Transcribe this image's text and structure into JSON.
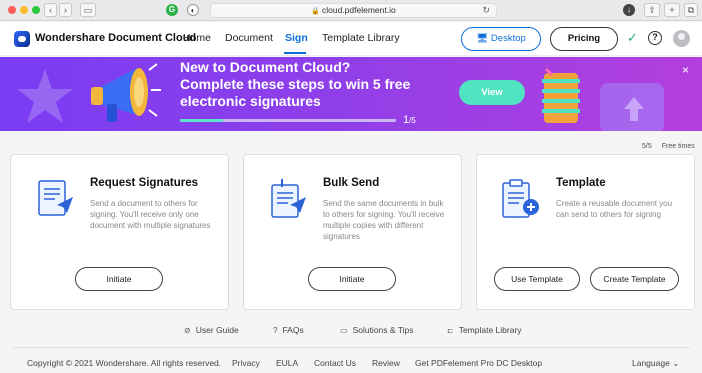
{
  "browser": {
    "url": "cloud.pdfelement.io",
    "nav_back": "‹",
    "nav_forward": "›"
  },
  "header": {
    "brand": "Wondershare Document Cloud",
    "nav": [
      "Home",
      "Document",
      "Sign",
      "Template Library"
    ],
    "active_nav": "Sign",
    "desktop_label": "Desktop",
    "pricing_label": "Pricing",
    "help_label": "?"
  },
  "banner": {
    "line1": "New to Document Cloud?",
    "line2": "Complete these steps to win 5 free",
    "line3": "electronic signatures",
    "progress_done": "1",
    "progress_total": "/5",
    "progress_fraction": 0.2,
    "view_label": "View",
    "close": "×"
  },
  "counter": {
    "value": "5/5",
    "label": "Free times"
  },
  "cards": [
    {
      "title": "Request Signatures",
      "desc": "Send a document to others for signing. You'll receive only one document with multiple signatures",
      "buttons": [
        "Initiate"
      ]
    },
    {
      "title": "Bulk Send",
      "desc": "Send the same documents in bulk to others for signing. You'll receive multiple copies with different signatures",
      "buttons": [
        "Initiate"
      ]
    },
    {
      "title": "Template",
      "desc": "Create a reusable document you can send to others for signing",
      "buttons": [
        "Use Template",
        "Create Template"
      ]
    }
  ],
  "footer": {
    "links": [
      "User Guide",
      "FAQs",
      "Solutions & Tips",
      "Template Library"
    ],
    "copyright": "Copyright © 2021 Wondershare. All rights reserved.",
    "bottom_links": [
      "Privacy",
      "EULA",
      "Contact Us",
      "Review",
      "Get PDFelement Pro DC Desktop"
    ],
    "language_label": "Language",
    "language_caret": "⌄"
  },
  "colors": {
    "accent": "#0d6ed9",
    "banner_start": "#7a3cf4",
    "banner_end": "#b33fdd",
    "view_button": "#4fe3c2",
    "check": "#1fb07a"
  }
}
